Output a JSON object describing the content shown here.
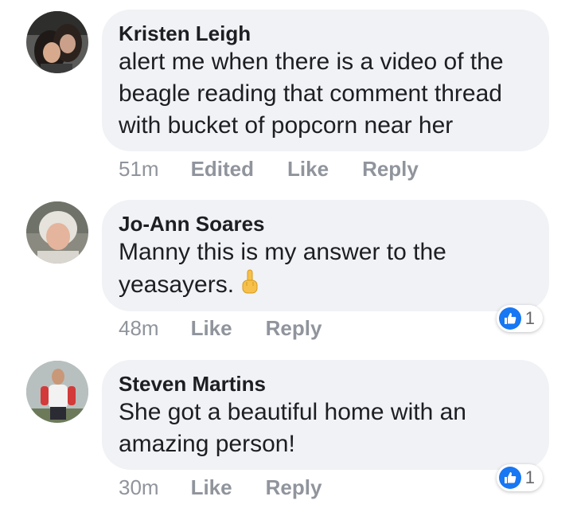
{
  "comments": [
    {
      "author": "Kristen Leigh",
      "lines": [
        "alert me when there is a video of the",
        "beagle reading that comment thread",
        "with bucket of popcorn near her"
      ],
      "time": "51m",
      "edited": "Edited",
      "like": "Like",
      "reply": "Reply"
    },
    {
      "author": "Jo-Ann Soares",
      "lines": [
        "Manny this is my answer to the",
        "yeasayers."
      ],
      "emoji": "middle-finger-emoji",
      "time": "48m",
      "like": "Like",
      "reply": "Reply",
      "reaction_count": "1"
    },
    {
      "author": "Steven Martins",
      "lines": [
        "She got a beautiful home with an",
        "amazing person!"
      ],
      "time": "30m",
      "like": "Like",
      "reply": "Reply",
      "reaction_count": "1"
    }
  ],
  "colors": {
    "bubble": "#f0f2f5",
    "meta": "#90949c",
    "like_blue": "#1877f2"
  }
}
